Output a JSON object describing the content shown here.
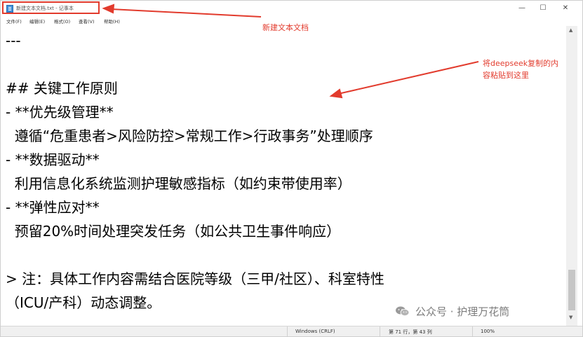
{
  "window": {
    "title": "新建文本文档.txt - 记事本",
    "minimize_glyph": "—",
    "maximize_glyph": "☐",
    "close_glyph": "✕"
  },
  "menu": [
    "文件(F)",
    "编辑(E)",
    "格式(O)",
    "查看(V)",
    "帮助(H)"
  ],
  "content_lines": [
    "---",
    "",
    "## 关键工作原则",
    "- **优先级管理**",
    "  遵循“危重患者>风险防控>常规工作>行政事务”处理顺序",
    "- **数据驱动**",
    "  利用信息化系统监测护理敏感指标（如约束带使用率）",
    "- **弹性应对**",
    "  预留20%时间处理突发任务（如公共卫生事件响应）",
    "",
    "> 注：具体工作内容需结合医院等级（三甲/社区）、科室特性",
    "（ICU/产科）动态调整。"
  ],
  "status": {
    "encoding": "Windows (CRLF)",
    "position": "第 71 行，第 43 列",
    "zoom": "100%"
  },
  "annotations": {
    "title_note": "新建文本文档",
    "paste_note_line1": "将deepseek复制的内",
    "paste_note_line2": "容粘贴到这里",
    "color": "#e23b2d"
  },
  "watermark": "公众号 · 护理万花筒",
  "icons": [
    "notepad-icon",
    "wechat-icon",
    "scroll-up-icon",
    "scroll-down-icon"
  ]
}
